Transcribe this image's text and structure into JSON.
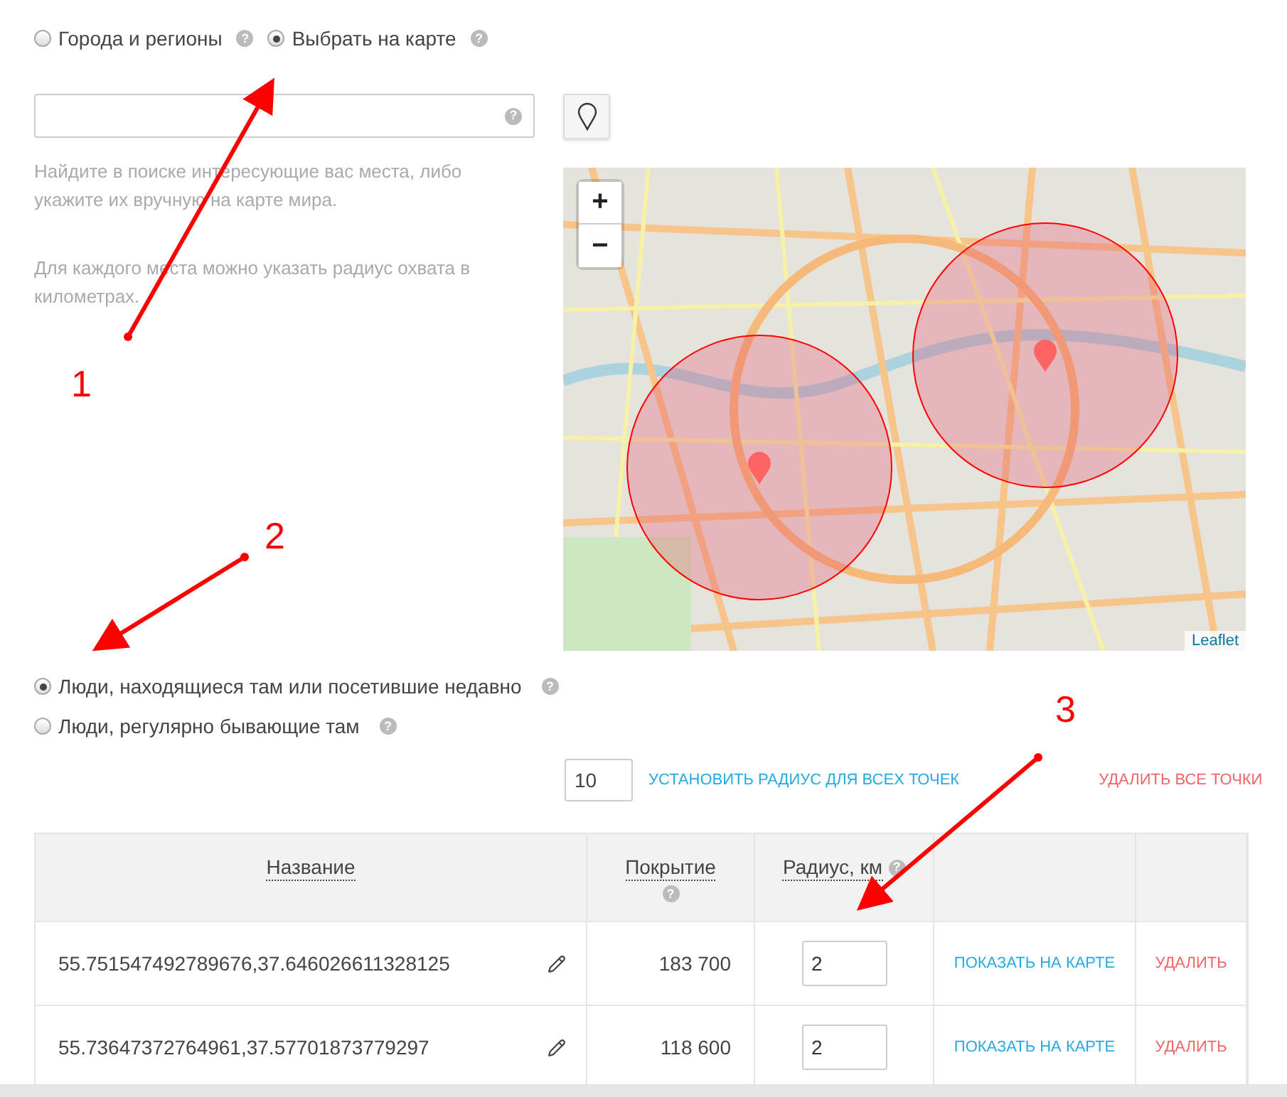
{
  "location_mode": [
    {
      "label": "Города и регионы",
      "selected": false,
      "help": "?"
    },
    {
      "label": "Выбрать на карте",
      "selected": true,
      "help": "?"
    }
  ],
  "search": {
    "help": "?"
  },
  "hints": [
    "Найдите в поиске интересующие вас места, либо укажите их вручную на карте мира.",
    "Для каждого места можно указать радиус охвата в километрах."
  ],
  "map": {
    "zoom_in": "+",
    "zoom_out": "−",
    "attribution": "Leaflet"
  },
  "audience": [
    {
      "label": "Люди, находящиеся там или посетившие недавно",
      "selected": true,
      "help": "?"
    },
    {
      "label": "Люди, регулярно бывающие там",
      "selected": false,
      "help": "?"
    }
  ],
  "bulk": {
    "radius": "10",
    "set_all": "УСТАНОВИТЬ РАДИУС ДЛЯ ВСЕХ ТОЧЕК",
    "delete_all": "УДАЛИТЬ ВСЕ ТОЧКИ"
  },
  "table": {
    "columns": [
      {
        "label": "Название"
      },
      {
        "label": "Покрытие",
        "help": "?"
      },
      {
        "label": "Радиус, км",
        "help": "?"
      }
    ],
    "rows": [
      {
        "name": "55.751547492789676,37.646026611328125",
        "coverage": "183 700",
        "radius": "2",
        "show": "ПОКАЗАТЬ НА КАРТЕ",
        "delete": "УДАЛИТЬ"
      },
      {
        "name": "55.73647372764961,37.57701873779297",
        "coverage": "118 600",
        "radius": "2",
        "show": "ПОКАЗАТЬ НА КАРТЕ",
        "delete": "УДАЛИТЬ"
      }
    ]
  },
  "annotations": [
    "1",
    "2",
    "3"
  ]
}
